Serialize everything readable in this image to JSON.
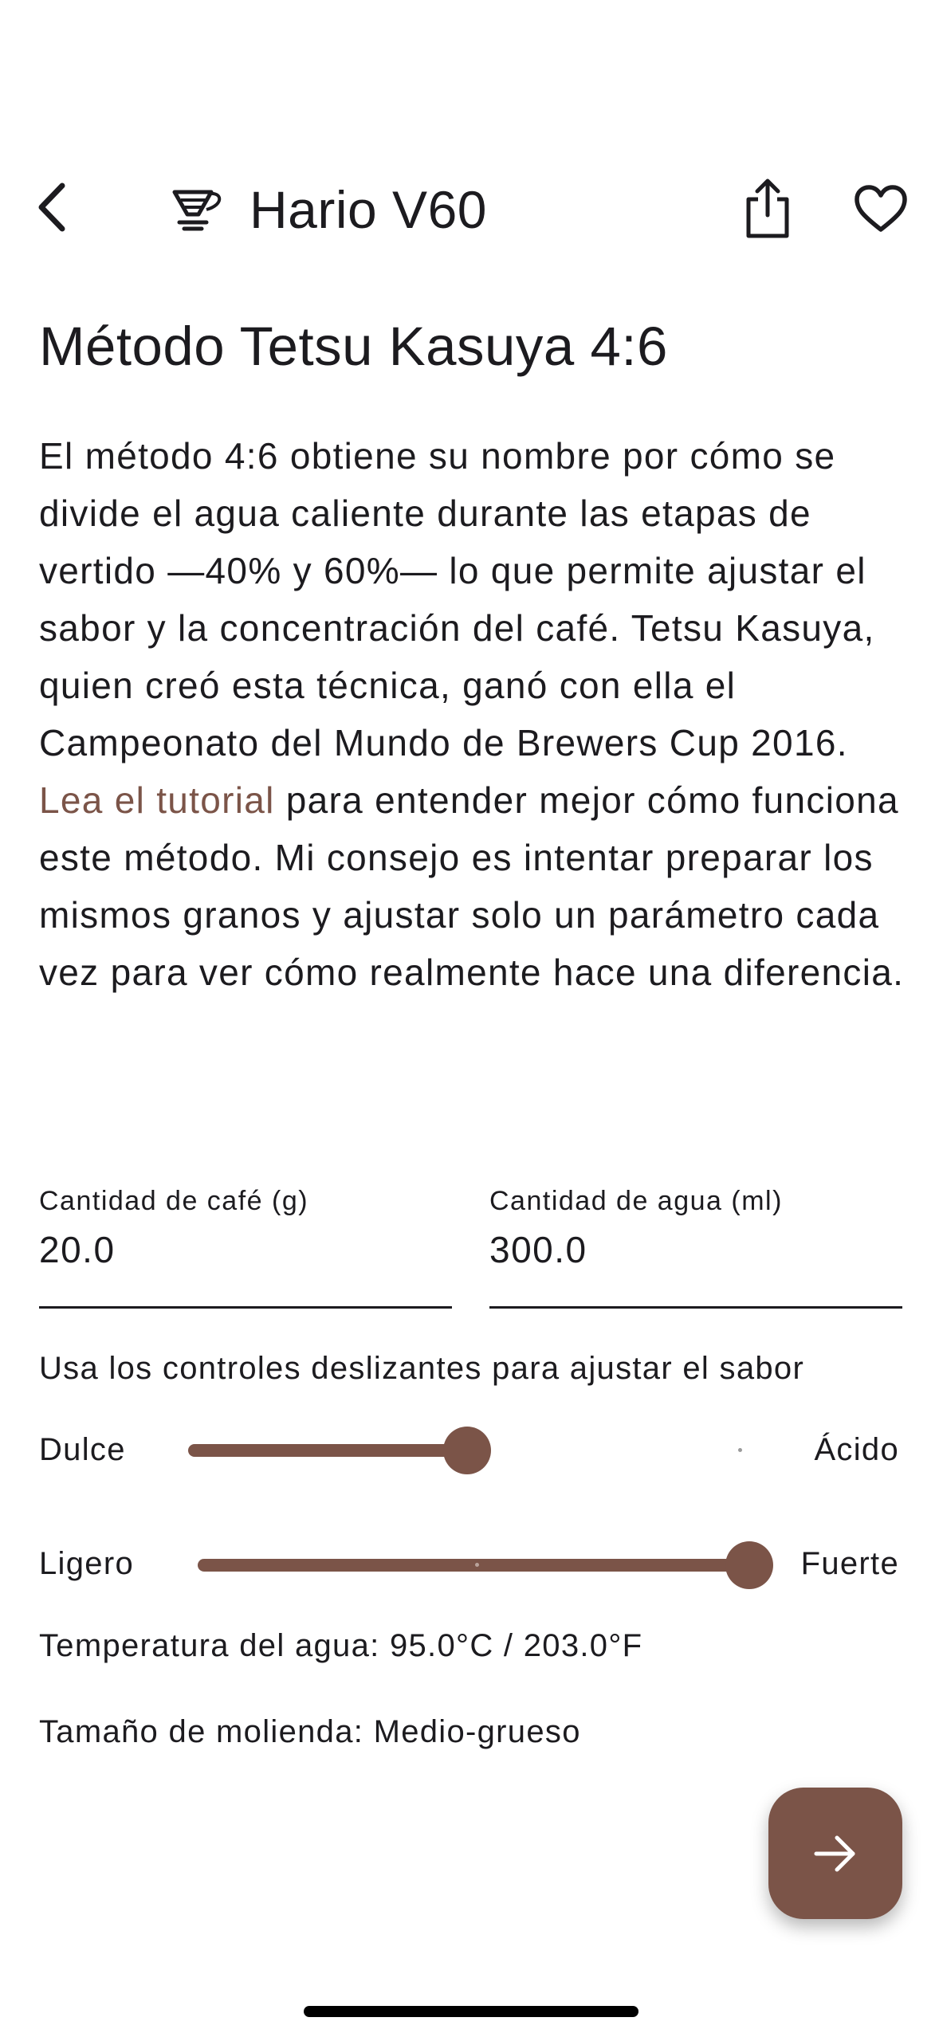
{
  "header": {
    "app_icon": "pour-over-dripper-icon",
    "title": "Hario V60",
    "back_icon": "chevron-left-icon",
    "share_icon": "share-icon",
    "favorite_icon": "heart-outline-icon"
  },
  "recipe": {
    "title": "Método Tetsu Kasuya 4:6",
    "description_before": "El método 4:6 obtiene su nombre por cómo se divide el agua caliente durante las etapas de vertido —40% y 60%— lo que permite ajustar el sabor y la concentración del café. Tetsu Kasuya, quien creó esta técnica, ganó con ella el Campeonato del Mundo de Brewers Cup 2016. ",
    "tutorial_link": "Lea el tutorial",
    "description_after": " para entender mejor cómo funciona este método. Mi consejo es intentar preparar los mismos granos y ajustar solo un parámetro cada vez para ver cómo realmente hace una diferencia."
  },
  "inputs": {
    "coffee": {
      "label": "Cantidad de café (g)",
      "value": "20.0"
    },
    "water": {
      "label": "Cantidad de agua (ml)",
      "value": "300.0"
    }
  },
  "sliders": {
    "hint": "Usa los controles deslizantes para ajustar el sabor",
    "sweetness": {
      "left_label": "Dulce",
      "right_label": "Ácido",
      "value": 0.5
    },
    "strength": {
      "left_label": "Ligero",
      "right_label": "Fuerte",
      "value": 1.0
    }
  },
  "info": {
    "water_temperature": "Temperatura del agua: 95.0°C / 203.0°F",
    "grind_size": "Tamaño de molienda: Medio-grueso"
  },
  "fab": {
    "icon": "arrow-right-icon"
  },
  "colors": {
    "accent": "#7b5448",
    "text": "#1c1b1f",
    "background": "#ffffff"
  }
}
